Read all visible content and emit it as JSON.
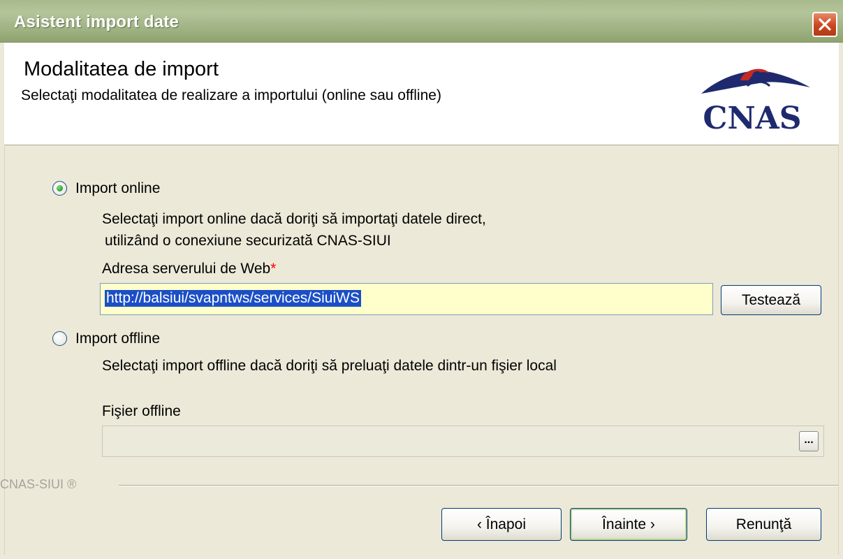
{
  "window": {
    "title": "Asistent import date",
    "close_icon": "close-icon"
  },
  "header": {
    "title": "Modalitatea de import",
    "subtitle": "Selectaţi modalitatea de realizare a importului (online sau offline)",
    "logo_text": "CNAS"
  },
  "online": {
    "label": "Import online",
    "selected": true,
    "description_line1": "Selectaţi import online dacă doriţi să importaţi datele direct,",
    "description_line2": "utilizând o conexiune securizată CNAS-SIUI",
    "server_label": "Adresa serverului de Web",
    "required_mark": "*",
    "server_value": "http://balsiui/svapntws/services/SiuiWS",
    "test_button": "Testează"
  },
  "offline": {
    "label": "Import offline",
    "selected": false,
    "description": "Selectaţi import offline dacă doriţi să preluaţi datele dintr-un fişier local",
    "file_label": "Fişier offline",
    "file_value": "",
    "browse_button": "..."
  },
  "footer": {
    "brand": "CNAS-SIUI ®",
    "back_button": "‹ Înapoi",
    "next_button": "Înainte ›",
    "cancel_button": "Renunţă"
  }
}
